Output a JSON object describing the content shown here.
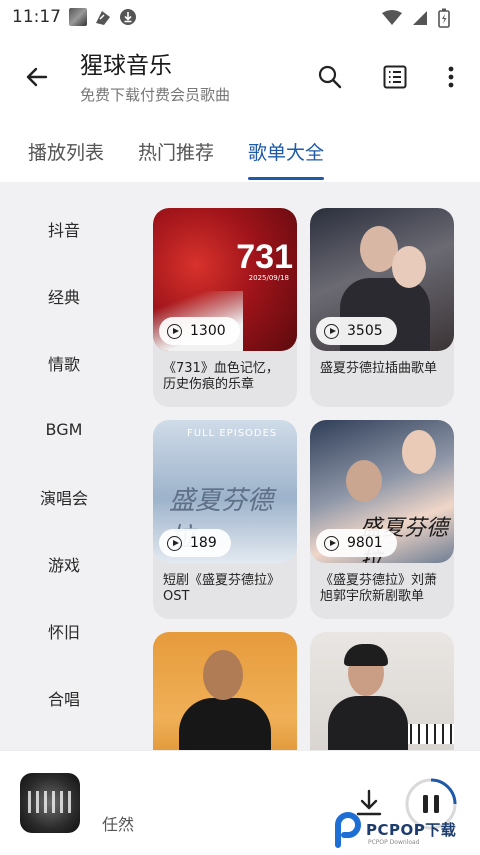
{
  "status_bar": {
    "time": "11:17"
  },
  "header": {
    "title": "猩球音乐",
    "subtitle": "免费下载付费会员歌曲"
  },
  "tabs": [
    {
      "label": "播放列表",
      "active": false
    },
    {
      "label": "热门推荐",
      "active": false
    },
    {
      "label": "歌单大全",
      "active": true
    }
  ],
  "sidebar": {
    "items": [
      "抖音",
      "经典",
      "情歌",
      "BGM",
      "演唱会",
      "游戏",
      "怀旧",
      "合唱"
    ]
  },
  "playlists": [
    {
      "title": "《731》血色记忆，历史伤痕的乐章",
      "plays": "1300",
      "cover_text": "731",
      "cover_date": "2025/09/18"
    },
    {
      "title": "盛夏芬德拉插曲歌单",
      "plays": "3505"
    },
    {
      "title": "短剧《盛夏芬德拉》OST",
      "plays": "189",
      "cover_text": "FULL EPISODES"
    },
    {
      "title": "《盛夏芬德拉》刘萧旭郭宇欣新剧歌单",
      "plays": "9801"
    },
    {
      "title": "",
      "plays": ""
    },
    {
      "title": "",
      "plays": ""
    }
  ],
  "player": {
    "artist": "任然"
  },
  "watermark": {
    "text": "PCPOP下载",
    "sub": "PCPOP Download"
  },
  "colors": {
    "accent": "#1f5aa8",
    "panel_bg": "#f1f1f3"
  }
}
